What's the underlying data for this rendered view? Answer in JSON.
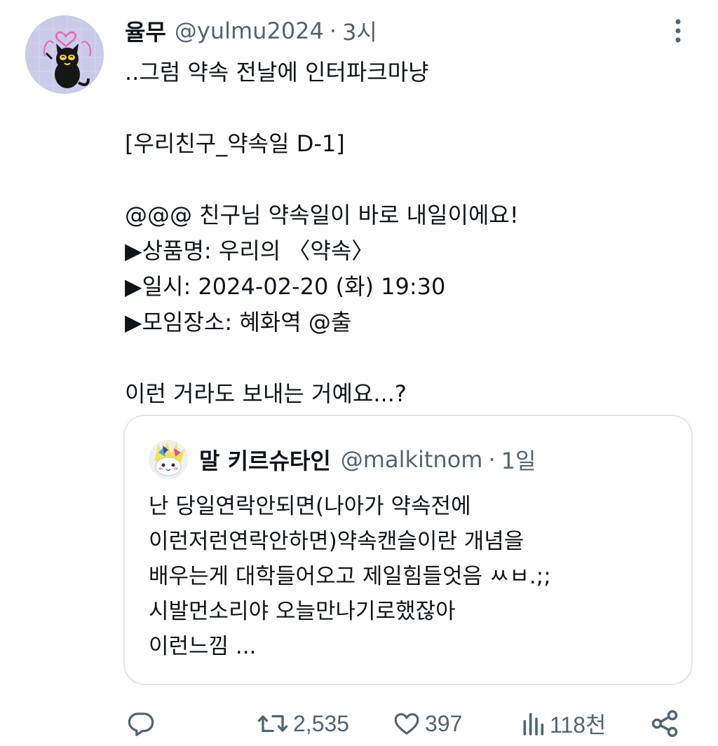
{
  "tweet": {
    "display_name": "율무",
    "handle": "@yulmu2024",
    "separator": "·",
    "time": "3시",
    "lines": [
      "..그럼 약속 전날에 인터파크마냥",
      "",
      "[우리친구_약속일 D-1]",
      "",
      "@@@ 친구님 약속일이 바로 내일이에요!",
      "▶상품명: 우리의 〈약속〉",
      "▶일시: 2024-02-20 (화) 19:30",
      "▶모임장소: 혜화역 @출",
      "",
      "이런 거라도 보내는 거예요...?"
    ]
  },
  "quoted_tweet": {
    "display_name": "말 키르슈타인",
    "handle": "@malkitnom",
    "separator": "·",
    "time": "1일",
    "lines": [
      "난 당일연락안되면(나아가 약속전에",
      "이런저런연락안하면)약속캔슬이란 개념을",
      "배우는게 대학들어오고 제일힘들엇음 ㅆㅂ.;;",
      "시발먼소리야 오늘만나기로했잖아",
      "이런느낌 ..."
    ]
  },
  "actions": {
    "reply": {
      "icon": "reply-icon",
      "count": ""
    },
    "retweet": {
      "icon": "retweet-icon",
      "count": "2,535"
    },
    "like": {
      "icon": "heart-icon",
      "count": "397"
    },
    "views": {
      "icon": "views-icon",
      "count": "118천"
    },
    "share": {
      "icon": "share-icon",
      "count": ""
    }
  },
  "colors": {
    "text": "#0f1419",
    "secondary": "#536471",
    "border": "#e3e7ea",
    "avatar_bg": "#c9cbe8"
  }
}
